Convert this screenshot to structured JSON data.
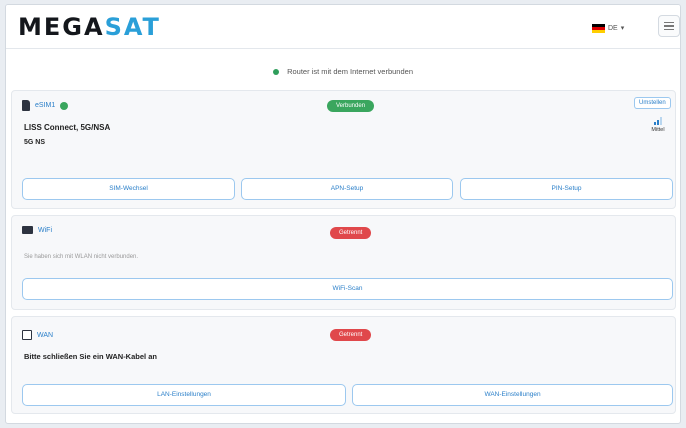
{
  "header": {
    "logo_part1": "MEGA",
    "logo_part2": "SAT",
    "language": "DE",
    "language_caret": "▾",
    "menu_icon": "hamburger-icon"
  },
  "status": {
    "text": "Router ist mit dem Internet verbunden",
    "color": "#2e9e5b"
  },
  "cards": {
    "sim": {
      "title": "eSIM1",
      "title_icon": "sim-card-icon",
      "badge": "Verbunden",
      "badge_color": "#3aa65e",
      "switch_label": "Umstellen",
      "provider": "LISS Connect, 5G/NSA",
      "network": "5G NS",
      "signal_label": "Mittel",
      "buttons": [
        "SIM-Wechsel",
        "APN-Setup",
        "PIN-Setup"
      ]
    },
    "wifi": {
      "title": "WiFi",
      "title_icon": "wifi-router-icon",
      "badge": "Getrennt",
      "badge_color": "#e0484b",
      "note": "Sie haben sich mit WLAN nicht verbunden.",
      "button": "WiFi-Scan"
    },
    "wan": {
      "title": "WAN",
      "title_icon": "ethernet-port-icon",
      "badge": "Getrennt",
      "badge_color": "#e0484b",
      "message": "Bitte schließen Sie ein WAN-Kabel an",
      "buttons": [
        "LAN-Einstellungen",
        "WAN-Einstellungen"
      ]
    }
  }
}
